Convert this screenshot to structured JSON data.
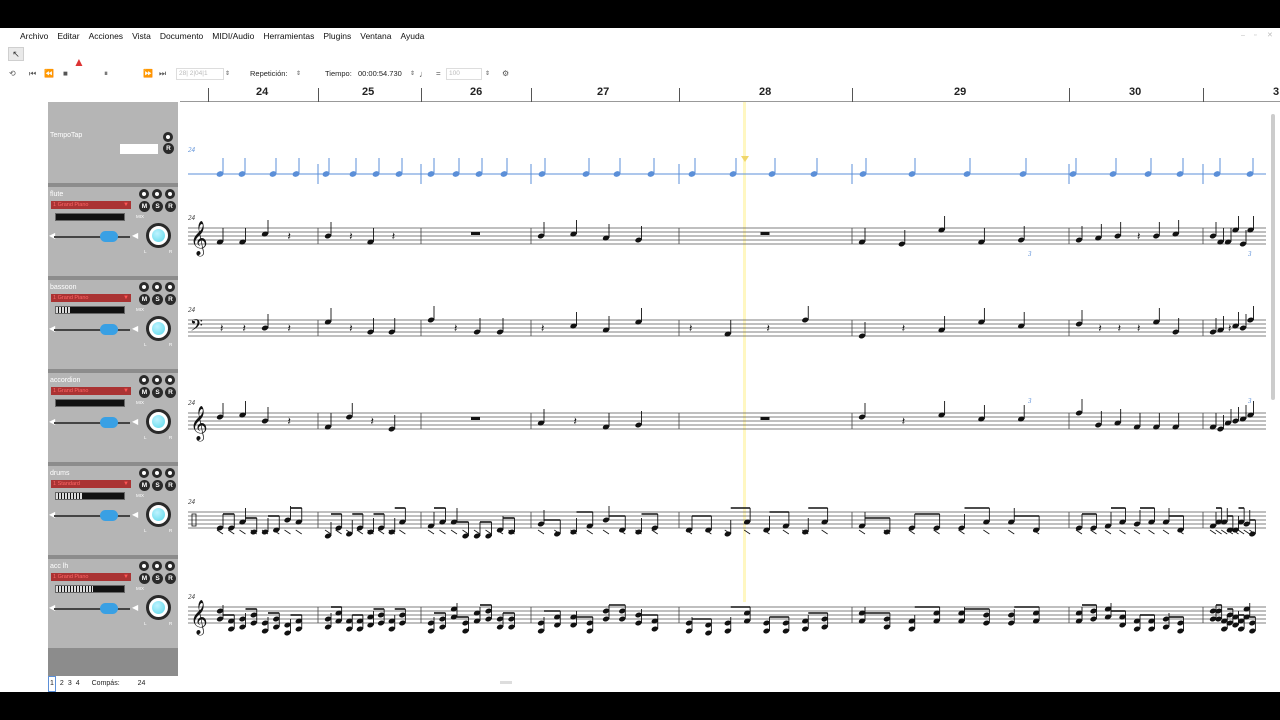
{
  "menu": [
    "Archivo",
    "Editar",
    "Acciones",
    "Vista",
    "Documento",
    "MIDI/Audio",
    "Herramientas",
    "Plugins",
    "Ventana",
    "Ayuda"
  ],
  "transport": {
    "position": "28| 2|04|1",
    "repeat_label": "Repetición:",
    "tempo_label": "Tiempo:",
    "time": "00:00:54.730",
    "tempo_value": "100"
  },
  "ruler": {
    "measures": [
      "24",
      "25",
      "26",
      "27",
      "28",
      "29",
      "30",
      "3"
    ]
  },
  "tracks": [
    {
      "name": "TempoTap",
      "instrument": "",
      "meter_level": 0,
      "slider_level": 0
    },
    {
      "name": "flute",
      "instrument": "1 Grand Piano",
      "meter_level": 0,
      "slider_level": 0.72
    },
    {
      "name": "bassoon",
      "instrument": "1 Grand Piano",
      "meter_level": 0.2,
      "slider_level": 0.72
    },
    {
      "name": "accordion",
      "instrument": "1 Grand Piano",
      "meter_level": 0,
      "slider_level": 0.72
    },
    {
      "name": "drums",
      "instrument": "1 Standard",
      "meter_level": 0.38,
      "slider_level": 0.72
    },
    {
      "name": "acc lh",
      "instrument": "1 Grand Piano",
      "meter_level": 0.54,
      "slider_level": 0.72
    }
  ],
  "buttons": {
    "mute": "M",
    "solo": "S",
    "record": "R",
    "mix": "MIX",
    "left": "L",
    "right": "R"
  },
  "staff_start_measure": "24",
  "triplet": "3",
  "status": {
    "pages": [
      "1",
      "2",
      "3",
      "4"
    ],
    "measure_label": "Compás:",
    "measure_value": "24"
  }
}
